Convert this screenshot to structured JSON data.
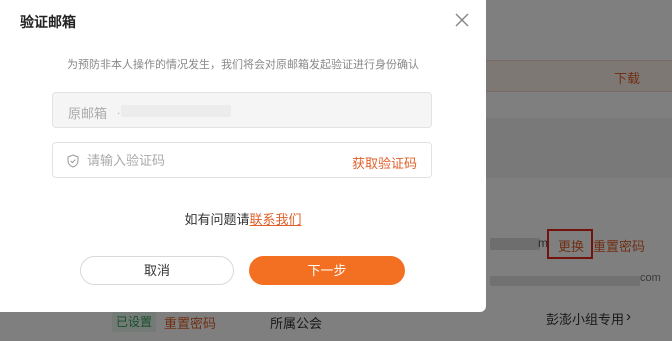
{
  "background": {
    "download_label": "下载",
    "email_tail": "m",
    "change_label": "更换",
    "reset_password_label": "重置密码",
    "row2_tail": "com",
    "set_badge": "已设置",
    "reset_password_label_2": "重置密码",
    "union_label": "所属公会",
    "group_label": "彭澎小组专用",
    "group_chevron": "›",
    "colors": {
      "accent": "#e0602a",
      "highlight_box": "#e3241b"
    }
  },
  "dialog": {
    "title": "验证邮箱",
    "close_icon": "close-icon",
    "tip": "为预防非本人操作的情况发生，我们将会对原邮箱发起验证进行身份确认",
    "original_email": {
      "label": "原邮箱",
      "value_masked": "."
    },
    "code_field": {
      "icon": "shield-icon",
      "placeholder": "请输入验证码",
      "value": "",
      "get_code_label": "获取验证码"
    },
    "help_text": "如有问题请",
    "help_link": "联系我们",
    "cancel_label": "取消",
    "next_label": "下一步",
    "colors": {
      "primary": "#f36f21",
      "link": "#e0602a"
    }
  }
}
